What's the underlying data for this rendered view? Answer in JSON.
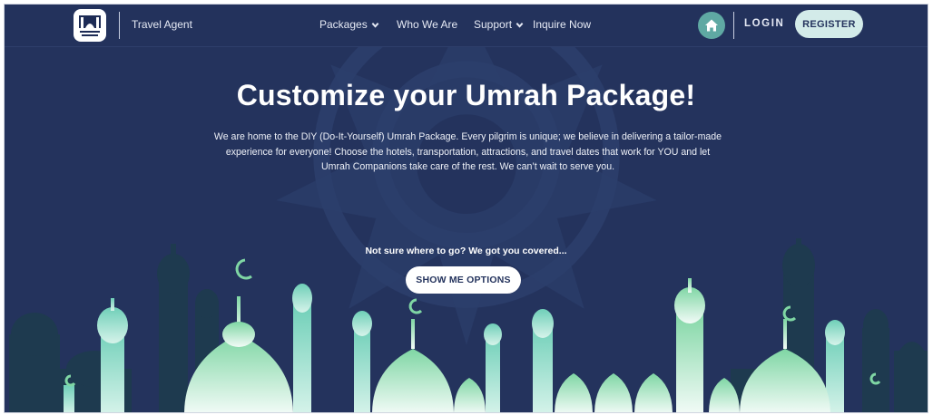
{
  "header": {
    "brand_label": "Travel Agent",
    "nav": [
      {
        "label": "Packages",
        "has_dropdown": true
      },
      {
        "label": "Who We Are",
        "has_dropdown": false
      },
      {
        "label": "Support",
        "has_dropdown": true
      },
      {
        "label": "Inquire Now",
        "has_dropdown": false
      }
    ],
    "home_icon": "home-icon",
    "login_label": "LOGIN",
    "register_label": "REGISTER"
  },
  "hero": {
    "title": "Customize your Umrah Package!",
    "description_lines": [
      "We are home to the DIY (Do-It-Yourself) Umrah Package. Every pilgrim is unique; we believe in delivering a tailor-made",
      "experience for everyone! Choose the hotels, transportation, attractions, and travel dates that work for YOU and let",
      "Umrah Companions take care of the rest. We can’t wait to serve you."
    ],
    "cover_text": "Not sure where to go? We got you covered...",
    "cta_label": "SHOW ME OPTIONS"
  },
  "colors": {
    "background": "#24335d",
    "accent_teal": "#5fa9a3",
    "register_bg": "#d3ebe9",
    "mosque_light": "#dff5ec",
    "mosque_green": "#7fd6a4",
    "mosque_dark": "#1e3a4f"
  }
}
